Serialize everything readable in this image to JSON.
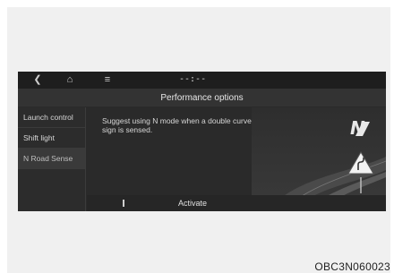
{
  "topbar": {
    "back_icon": "chevron-left-icon",
    "home_icon": "home-icon",
    "menu_icon": "menu-icon",
    "clock": "--:--"
  },
  "title": "Performance options",
  "sidebar": {
    "items": [
      {
        "label": "Launch control",
        "active": false
      },
      {
        "label": "Shift light",
        "active": false
      },
      {
        "label": "N Road Sense",
        "active": true
      }
    ]
  },
  "content": {
    "message": "Suggest using N mode when a double curve sign is sensed.",
    "logo_icon": "n-logo-icon",
    "sign_icon": "double-curve-sign-icon"
  },
  "bottombar": {
    "activate_label": "Activate"
  },
  "caption": "OBC3N060023",
  "colors": {
    "screen_bg": "#2a2a2a",
    "topbar_bg": "#1e1e1e",
    "titlebar_bg": "#333333",
    "text": "#dddddd"
  }
}
